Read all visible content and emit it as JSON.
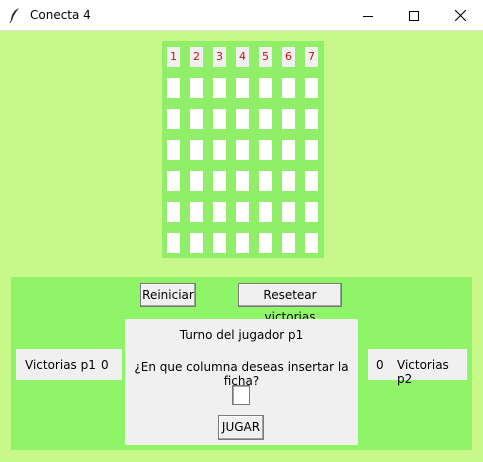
{
  "window": {
    "title": "Conecta 4",
    "app_icon": "feather-icon",
    "controls": [
      "minimize-icon",
      "maximize-icon",
      "close-icon"
    ]
  },
  "colors": {
    "background": "#c8f88a",
    "board": "#90ee68",
    "panel": "#90f468",
    "column_number": "#d01010"
  },
  "board": {
    "columns": [
      "1",
      "2",
      "3",
      "4",
      "5",
      "6",
      "7"
    ],
    "rows": 6,
    "cells": [
      [
        "",
        "",
        "",
        "",
        "",
        "",
        ""
      ],
      [
        "",
        "",
        "",
        "",
        "",
        "",
        ""
      ],
      [
        "",
        "",
        "",
        "",
        "",
        "",
        ""
      ],
      [
        "",
        "",
        "",
        "",
        "",
        "",
        ""
      ],
      [
        "",
        "",
        "",
        "",
        "",
        "",
        ""
      ],
      [
        "",
        "",
        "",
        "",
        "",
        "",
        ""
      ]
    ]
  },
  "controls": {
    "restart_label": "Reiniciar",
    "reset_wins_label": "Resetear victorias",
    "play_label": "JUGAR"
  },
  "scores": {
    "p1": {
      "label": "Victorias p1",
      "value": "0"
    },
    "p2": {
      "label": "Victorias p2",
      "value": "0"
    }
  },
  "turn": {
    "text": "Turno del jugador p1",
    "question": "¿En que columna deseas insertar la ficha?",
    "column_input": ""
  }
}
